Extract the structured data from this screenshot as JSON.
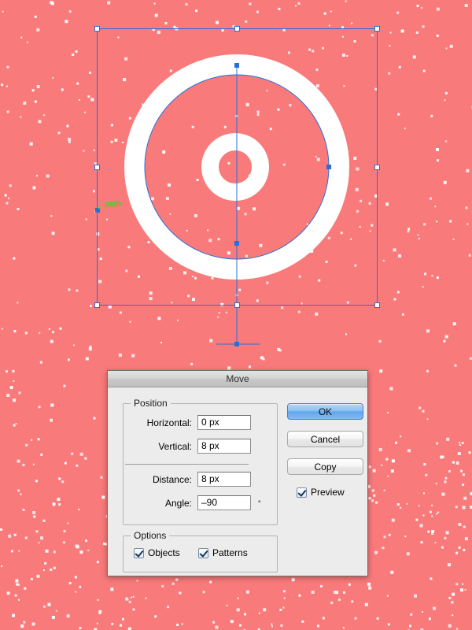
{
  "app": {
    "canvas": {
      "background_color": "#f97a7a",
      "dot_color": "#ffffff",
      "artwork_color": "#ffffff",
      "selection_color": "#2a6fd8",
      "smart_guide_color": "#49e02a",
      "smart_guide_label": "path",
      "smart_guide_marker": "x"
    }
  },
  "dialog": {
    "title": "Move",
    "position_group": {
      "legend": "Position",
      "fields": [
        {
          "label": "Horizontal:",
          "value": "0 px",
          "unit": ""
        },
        {
          "label": "Vertical:",
          "value": "8 px",
          "unit": ""
        },
        {
          "label": "Distance:",
          "value": "8 px",
          "unit": ""
        },
        {
          "label": "Angle:",
          "value": "–90",
          "unit": "°"
        }
      ]
    },
    "options_group": {
      "legend": "Options",
      "checkboxes": [
        {
          "label": "Objects",
          "checked": true
        },
        {
          "label": "Patterns",
          "checked": true
        }
      ]
    },
    "buttons": [
      {
        "label": "OK",
        "primary": true
      },
      {
        "label": "Cancel",
        "primary": false
      },
      {
        "label": "Copy",
        "primary": false
      }
    ],
    "preview": {
      "label": "Preview",
      "checked": true
    }
  }
}
